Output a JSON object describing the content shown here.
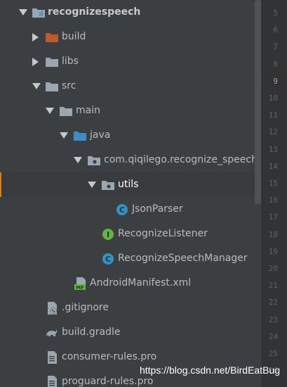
{
  "tree": {
    "items": [
      {
        "label": "recognizespeech",
        "icon": "module-folder-icon",
        "expanded": true
      },
      {
        "label": "build",
        "icon": "folder-orange-icon",
        "expanded": false
      },
      {
        "label": "libs",
        "icon": "folder-icon",
        "expanded": false
      },
      {
        "label": "src",
        "icon": "folder-icon",
        "expanded": true
      },
      {
        "label": "main",
        "icon": "folder-icon",
        "expanded": true
      },
      {
        "label": "java",
        "icon": "source-folder-icon",
        "expanded": true
      },
      {
        "label": "com.qiqilego.recognize_speech",
        "icon": "package-icon",
        "expanded": true
      },
      {
        "label": "utils",
        "icon": "package-icon",
        "expanded": true,
        "selected": true
      },
      {
        "label": "JsonParser",
        "icon": "class-icon"
      },
      {
        "label": "RecognizeListener",
        "icon": "interface-icon"
      },
      {
        "label": "RecognizeSpeechManager",
        "icon": "class-icon"
      },
      {
        "label": "AndroidManifest.xml",
        "icon": "manifest-icon"
      },
      {
        "label": ".gitignore",
        "icon": "gitignore-file-icon"
      },
      {
        "label": "build.gradle",
        "icon": "gradle-icon"
      },
      {
        "label": "consumer-rules.pro",
        "icon": "text-file-icon"
      },
      {
        "label": "proguard-rules.pro",
        "icon": "text-file-icon"
      }
    ]
  },
  "gutter": {
    "line_numbers": [
      "5",
      "6",
      "7",
      "8",
      "9",
      "10",
      "11",
      "12",
      "13",
      "14",
      "15",
      "16",
      "17",
      "18",
      "19",
      "20",
      "21",
      "22",
      "23",
      "24",
      "25",
      "26"
    ],
    "current_line": "9"
  },
  "watermark": "https://blog.csdn.net/BirdEatBug",
  "colors": {
    "selection_accent": "#d67e1d",
    "folder_orange": "#c3582a",
    "source_folder_blue": "#3d8bc9",
    "class_teal": "#3592c4",
    "interface_green": "#62b543"
  }
}
